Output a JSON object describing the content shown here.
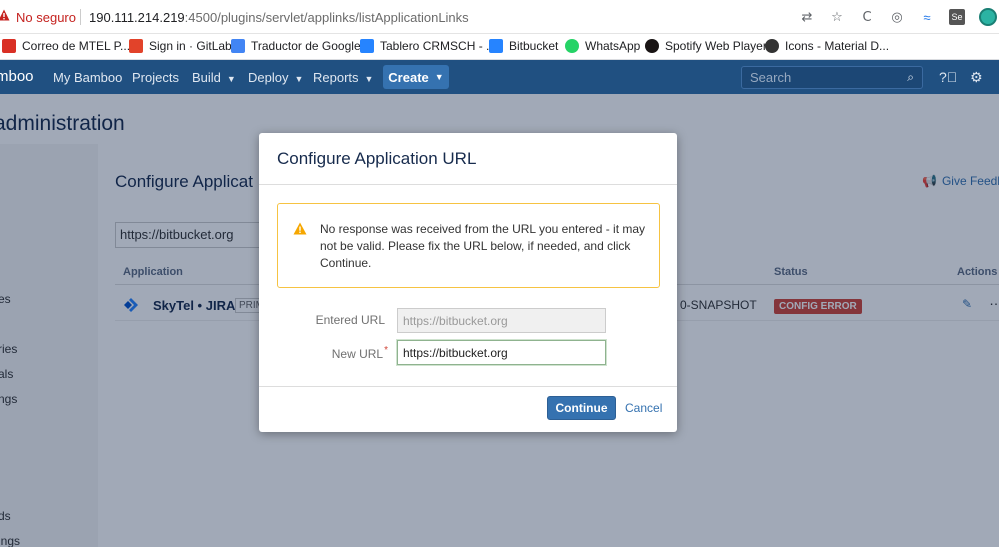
{
  "browser": {
    "security_label": "No seguro",
    "url_host": "190.111.214.219",
    "url_rest": ":4500/plugins/servlet/applinks/listApplicationLinks",
    "bookmarks": [
      {
        "label": "Correo de MTEL P...",
        "color": "#d93025"
      },
      {
        "label": "Sign in · GitLab",
        "color": "#e2432a"
      },
      {
        "label": "Traductor de Google",
        "color": "#4285f4"
      },
      {
        "label": "Tablero CRMSCH - ...",
        "color": "#2684ff"
      },
      {
        "label": "Bitbucket",
        "color": "#2684ff"
      },
      {
        "label": "WhatsApp",
        "color": "#25d366"
      },
      {
        "label": "Spotify Web Player",
        "color": "#191414"
      },
      {
        "label": "Icons - Material D...",
        "color": "#333333"
      }
    ]
  },
  "bamboo": {
    "logo": "mboo",
    "nav": [
      "My Bamboo",
      "Projects",
      "Build",
      "Deploy",
      "Reports"
    ],
    "create": "Create",
    "search_placeholder": "Search"
  },
  "page": {
    "admin_title": "administration",
    "section_title": "Configure Applicat",
    "give_feedback": "Give Feedb",
    "url_input_value": "https://bitbucket.org",
    "sidebar_fragments": [
      "es",
      "ries",
      "als",
      "ngs",
      "ds",
      "ings"
    ],
    "table": {
      "headers": [
        "Application",
        "Status",
        "Actions"
      ],
      "row": {
        "name": "SkyTel • JIRA",
        "badge": "PRIM",
        "version": "0-SNAPSHOT",
        "status": "CONFIG ERROR"
      }
    }
  },
  "dialog": {
    "title": "Configure Application URL",
    "warning": "No response was received from the URL you entered - it may not be valid. Please fix the URL below, if needed, and click Continue.",
    "entered_label": "Entered URL",
    "entered_value": "https://bitbucket.org",
    "new_label": "New URL",
    "required_mark": "*",
    "new_value": "https://bitbucket.org",
    "continue_label": "Continue",
    "cancel_label": "Cancel"
  },
  "colors": {
    "header": "#205081",
    "primary": "#3572b0",
    "warning_border": "#f6c342",
    "error": "#d04437"
  }
}
